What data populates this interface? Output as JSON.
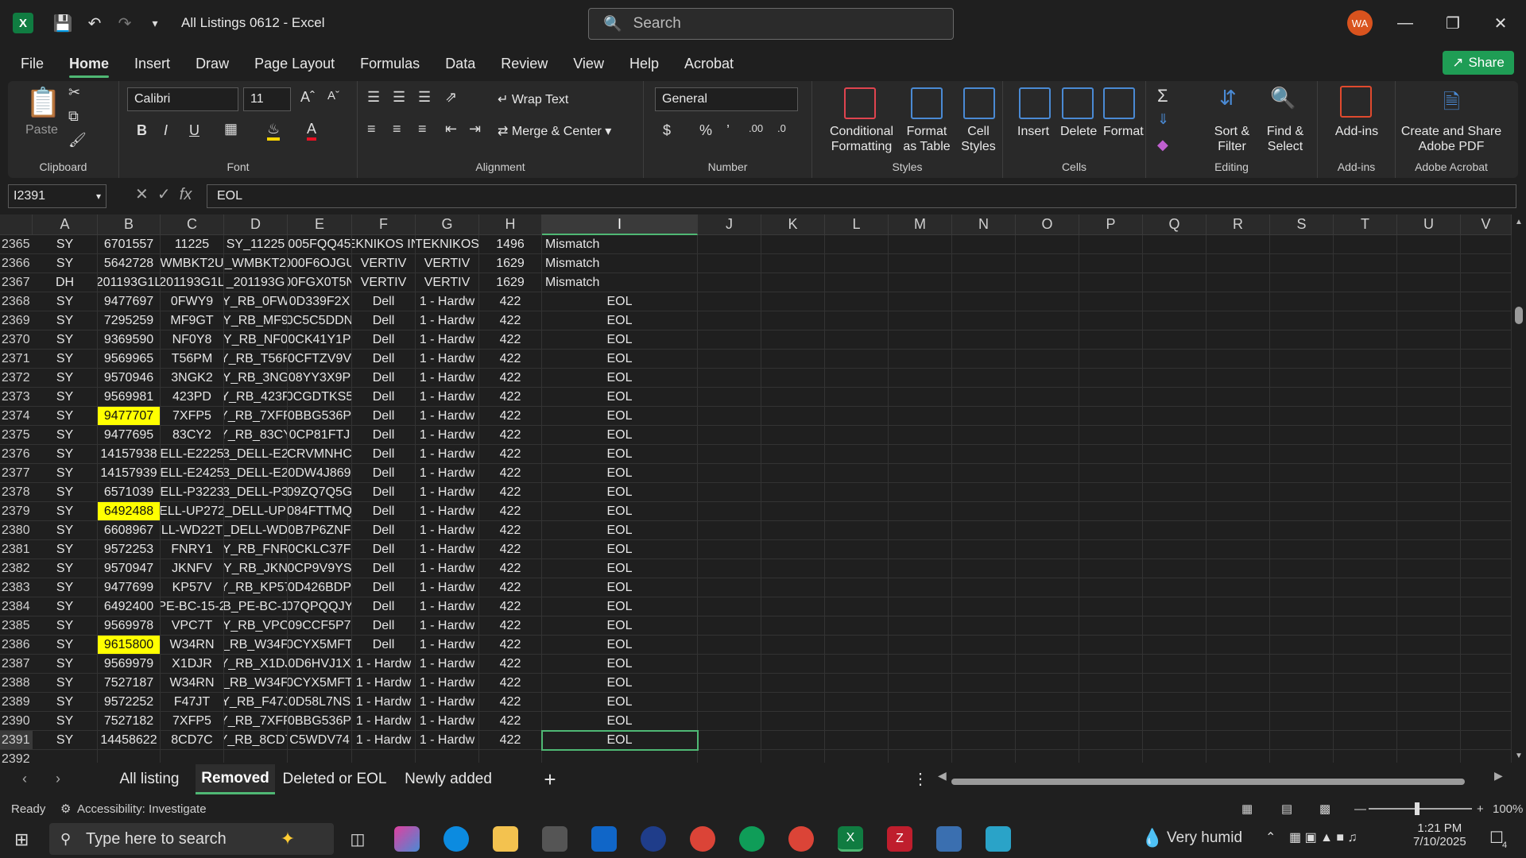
{
  "titlebar": {
    "doc_title": "All Listings 0612  -  Excel",
    "search_placeholder": "Search",
    "avatar": "WA"
  },
  "menu": [
    "File",
    "Home",
    "Insert",
    "Draw",
    "Page Layout",
    "Formulas",
    "Data",
    "Review",
    "View",
    "Help",
    "Acrobat"
  ],
  "share_label": "Share",
  "ribbon": {
    "clipboard": {
      "paste": "Paste",
      "label": "Clipboard"
    },
    "font": {
      "family": "Calibri",
      "size": "11",
      "label": "Font"
    },
    "alignment": {
      "wrap": "Wrap Text",
      "merge": "Merge & Center",
      "label": "Alignment"
    },
    "number": {
      "format": "General",
      "label": "Number"
    },
    "styles": {
      "conditional": "Conditional Formatting",
      "format_table": "Format as Table",
      "cell_styles": "Cell Styles",
      "label": "Styles"
    },
    "cells": {
      "insert": "Insert",
      "delete": "Delete",
      "format": "Format",
      "label": "Cells"
    },
    "editing": {
      "sort": "Sort & Filter",
      "find": "Find & Select",
      "label": "Editing"
    },
    "addins": {
      "addins": "Add-ins",
      "label": "Add-ins"
    },
    "acrobat": {
      "create": "Create and Share Adobe PDF",
      "label": "Adobe Acrobat"
    }
  },
  "formula": {
    "namebox": "I2391",
    "fx": "fx",
    "value": "EOL"
  },
  "columns": [
    "A",
    "B",
    "C",
    "D",
    "E",
    "F",
    "G",
    "H",
    "I",
    "J",
    "K",
    "L",
    "M",
    "N",
    "O",
    "P",
    "Q",
    "R",
    "S",
    "T",
    "U",
    "V"
  ],
  "rows": [
    {
      "n": "2365",
      "a": "SY",
      "b": "6701557",
      "c": "11225",
      "d": "SY_11225",
      "e": "005FQQ45",
      "f": "EKNIKOS IN",
      "g": "TEKNIKOS",
      "h": "1496",
      "i": "Mismatch"
    },
    {
      "n": "2366",
      "a": "SY",
      "b": "5642728",
      "c": "WMBKT2U",
      "d": "_WMBKT2",
      "e": "000F6OJGU",
      "f": "VERTIV",
      "g": "VERTIV",
      "h": "1629",
      "i": "Mismatch"
    },
    {
      "n": "2367",
      "a": "DH",
      "b": "201193G1L",
      "c": "201193G1L",
      "d": "_201193G",
      "e": "00FGX0T5N",
      "f": "VERTIV",
      "g": "VERTIV",
      "h": "1629",
      "i": "Mismatch"
    },
    {
      "n": "2368",
      "a": "SY",
      "b": "9477697",
      "c": "0FWY9",
      "d": "Y_RB_0FW",
      "e": "0D339F2X",
      "f": "Dell",
      "g": "1 - Hardw",
      "h": "422",
      "i": "EOL"
    },
    {
      "n": "2369",
      "a": "SY",
      "b": "7295259",
      "c": "MF9GT",
      "d": "Y_RB_MF9",
      "e": "0C5C5DDN",
      "f": "Dell",
      "g": "1 - Hardw",
      "h": "422",
      "i": "EOL"
    },
    {
      "n": "2370",
      "a": "SY",
      "b": "9369590",
      "c": "NF0Y8",
      "d": "Y_RB_NF0",
      "e": "0CK41Y1P",
      "f": "Dell",
      "g": "1 - Hardw",
      "h": "422",
      "i": "EOL"
    },
    {
      "n": "2371",
      "a": "SY",
      "b": "9569965",
      "c": "T56PM",
      "d": "Y_RB_T56P",
      "e": "0CFTZV9V",
      "f": "Dell",
      "g": "1 - Hardw",
      "h": "422",
      "i": "EOL"
    },
    {
      "n": "2372",
      "a": "SY",
      "b": "9570946",
      "c": "3NGK2",
      "d": "Y_RB_3NG",
      "e": "08YY3X9P",
      "f": "Dell",
      "g": "1 - Hardw",
      "h": "422",
      "i": "EOL"
    },
    {
      "n": "2373",
      "a": "SY",
      "b": "9569981",
      "c": "423PD",
      "d": "Y_RB_423P",
      "e": "0CGDTKS5",
      "f": "Dell",
      "g": "1 - Hardw",
      "h": "422",
      "i": "EOL"
    },
    {
      "n": "2374",
      "a": "SY",
      "b": "9477707",
      "c": "7XFP5",
      "d": "Y_RB_7XFP",
      "e": "0BBG536P",
      "f": "Dell",
      "g": "1 - Hardw",
      "h": "422",
      "i": "EOL",
      "hl": true
    },
    {
      "n": "2375",
      "a": "SY",
      "b": "9477695",
      "c": "83CY2",
      "d": "Y_RB_83CY",
      "e": "0CP81FTJ",
      "f": "Dell",
      "g": "1 - Hardw",
      "h": "422",
      "i": "EOL"
    },
    {
      "n": "2376",
      "a": "SY",
      "b": "14157938",
      "c": "ELL-E2225",
      "d": "3_DELL-E2",
      "e": "CRVMNHC",
      "f": "Dell",
      "g": "1 - Hardw",
      "h": "422",
      "i": "EOL"
    },
    {
      "n": "2377",
      "a": "SY",
      "b": "14157939",
      "c": "ELL-E2425",
      "d": "3_DELL-E2",
      "e": "0DW4J869",
      "f": "Dell",
      "g": "1 - Hardw",
      "h": "422",
      "i": "EOL"
    },
    {
      "n": "2378",
      "a": "SY",
      "b": "6571039",
      "c": "ELL-P3223",
      "d": "3_DELL-P3",
      "e": "09ZQ7Q5G",
      "f": "Dell",
      "g": "1 - Hardw",
      "h": "422",
      "i": "EOL"
    },
    {
      "n": "2379",
      "a": "SY",
      "b": "6492488",
      "c": "ELL-UP272",
      "d": "_DELL-UP",
      "e": "084FTTMQ",
      "f": "Dell",
      "g": "1 - Hardw",
      "h": "422",
      "i": "EOL",
      "hl": true
    },
    {
      "n": "2380",
      "a": "SY",
      "b": "6608967",
      "c": "LL-WD22T",
      "d": "_DELL-WD",
      "e": "0B7P6ZNF",
      "f": "Dell",
      "g": "1 - Hardw",
      "h": "422",
      "i": "EOL"
    },
    {
      "n": "2381",
      "a": "SY",
      "b": "9572253",
      "c": "FNRY1",
      "d": "Y_RB_FNR",
      "e": "0CKLC37F",
      "f": "Dell",
      "g": "1 - Hardw",
      "h": "422",
      "i": "EOL"
    },
    {
      "n": "2382",
      "a": "SY",
      "b": "9570947",
      "c": "JKNFV",
      "d": "Y_RB_JKN",
      "e": "0CP9V9YS",
      "f": "Dell",
      "g": "1 - Hardw",
      "h": "422",
      "i": "EOL"
    },
    {
      "n": "2383",
      "a": "SY",
      "b": "9477699",
      "c": "KP57V",
      "d": "Y_RB_KP57",
      "e": "0D426BDP",
      "f": "Dell",
      "g": "1 - Hardw",
      "h": "422",
      "i": "EOL"
    },
    {
      "n": "2384",
      "a": "SY",
      "b": "6492400",
      "c": "PE-BC-15-2",
      "d": "B_PE-BC-1",
      "e": "07QPQQJY",
      "f": "Dell",
      "g": "1 - Hardw",
      "h": "422",
      "i": "EOL"
    },
    {
      "n": "2385",
      "a": "SY",
      "b": "9569978",
      "c": "VPC7T",
      "d": "Y_RB_VPC",
      "e": "09CCF5P7",
      "f": "Dell",
      "g": "1 - Hardw",
      "h": "422",
      "i": "EOL"
    },
    {
      "n": "2386",
      "a": "SY",
      "b": "9615800",
      "c": "W34RN",
      "d": "_RB_W34F",
      "e": "0CYX5MFT",
      "f": "Dell",
      "g": "1 - Hardw",
      "h": "422",
      "i": "EOL",
      "hl": true
    },
    {
      "n": "2387",
      "a": "SY",
      "b": "9569979",
      "c": "X1DJR",
      "d": "Y_RB_X1DJ",
      "e": "0D6HVJ1X",
      "f": "1 - Hardw",
      "g": "1 - Hardw",
      "h": "422",
      "i": "EOL"
    },
    {
      "n": "2388",
      "a": "SY",
      "b": "7527187",
      "c": "W34RN",
      "d": "_RB_W34F",
      "e": "0CYX5MFT",
      "f": "1 - Hardw",
      "g": "1 - Hardw",
      "h": "422",
      "i": "EOL"
    },
    {
      "n": "2389",
      "a": "SY",
      "b": "9572252",
      "c": "F47JT",
      "d": "Y_RB_F47J",
      "e": "0D58L7NS",
      "f": "1 - Hardw",
      "g": "1 - Hardw",
      "h": "422",
      "i": "EOL"
    },
    {
      "n": "2390",
      "a": "SY",
      "b": "7527182",
      "c": "7XFP5",
      "d": "Y_RB_7XFP",
      "e": "0BBG536P",
      "f": "1 - Hardw",
      "g": "1 - Hardw",
      "h": "422",
      "i": "EOL"
    },
    {
      "n": "2391",
      "a": "SY",
      "b": "14458622",
      "c": "8CD7C",
      "d": "Y_RB_8CD7",
      "e": "C5WDV74",
      "f": "1 - Hardw",
      "g": "1 - Hardw",
      "h": "422",
      "i": "EOL"
    },
    {
      "n": "2392",
      "a": "",
      "b": "",
      "c": "",
      "d": "",
      "e": "",
      "f": "",
      "g": "",
      "h": "",
      "i": ""
    }
  ],
  "sheets": [
    "All listing",
    "Removed",
    "Deleted or EOL",
    "Newly added"
  ],
  "active_sheet": "Removed",
  "status": {
    "ready": "Ready",
    "accessibility": "Accessibility: Investigate",
    "zoom": "100%"
  },
  "taskbar": {
    "search_placeholder": "Type here to search",
    "weather": "Very humid",
    "time": "1:21 PM",
    "date": "7/10/2025",
    "notif_count": "4"
  },
  "colors": {
    "accent": "#4fb874",
    "highlight": "#ffff00",
    "excel": "#107c41"
  }
}
